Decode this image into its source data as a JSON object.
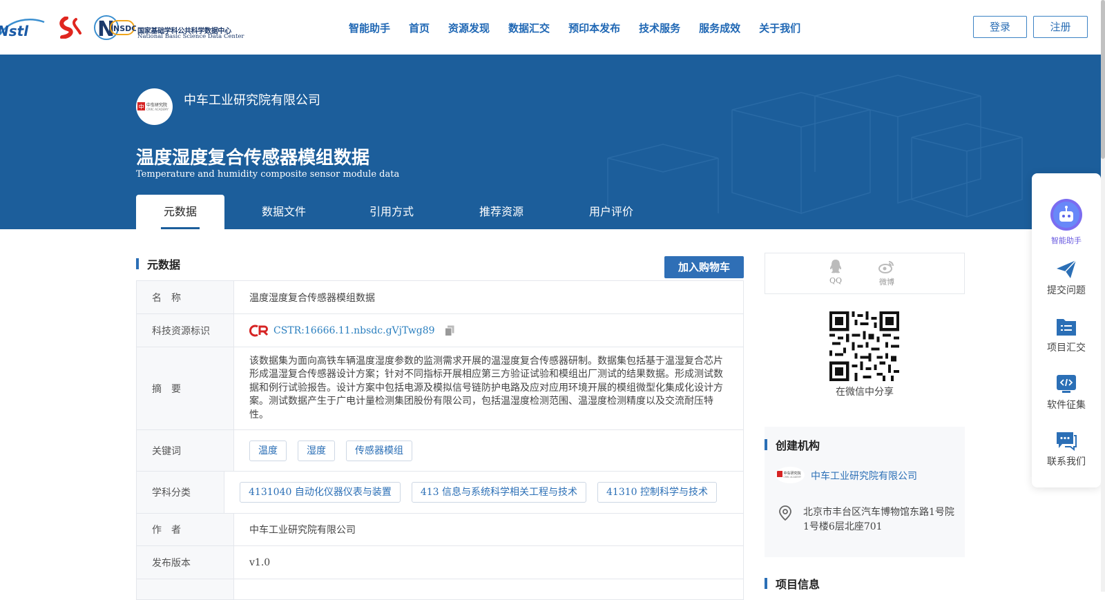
{
  "header": {
    "logos": {
      "nstl": "NSTL",
      "nsdc_badge": "NSDC",
      "nsdc_cn": "国家基础学科公共科学数据中心",
      "nsdc_en": "National Basic Science Data Center"
    },
    "nav": [
      "智能助手",
      "首页",
      "资源发现",
      "数据汇交",
      "预印本发布",
      "技术服务",
      "服务成效",
      "关于我们"
    ],
    "login": "登录",
    "register": "注册"
  },
  "hero": {
    "org_name": "中车工业研究院有限公司",
    "org_logo_text": "中车研究院",
    "title": "温度湿度复合传感器模组数据",
    "subtitle": "Temperature and humidity composite sensor module data",
    "tabs": [
      "元数据",
      "数据文件",
      "引用方式",
      "推荐资源",
      "用户评价"
    ],
    "active_tab": "元数据"
  },
  "metadata": {
    "section_title": "元数据",
    "cart_button": "加入购物车",
    "rows": {
      "name": {
        "label": "名　称",
        "value": "温度湿度复合传感器模组数据"
      },
      "cstr": {
        "label": "科技资源标识",
        "value": "CSTR:16666.11.nbsdc.gVjTwg89"
      },
      "abstract": {
        "label": "摘　要",
        "value": "该数据集为面向高铁车辆温度湿度参数的监测需求开展的温湿度复合传感器研制。数据集包括基于温湿复合芯片形成温湿复合传感器设计方案；针对不同指标开展相应第三方验证试验和模组出厂测试的结果数据。形成测试数据和例行试验报告。设计方案中包括电源及模拟信号链防护电路及应对应用环境开展的模组微型化集成化设计方案。测试数据产生于广电计量检测集团股份有限公司，包括温湿度检测范围、温湿度检测精度以及交流耐压特性。"
      },
      "keywords": {
        "label": "关键词",
        "tags": [
          "温度",
          "湿度",
          "传感器模组"
        ]
      },
      "subjects": {
        "label": "学科分类",
        "tags": [
          "4131040 自动化仪器仪表与装置",
          "413 信息与系统科学相关工程与技术",
          "41310 控制科学与技术"
        ]
      },
      "author": {
        "label": "作　者",
        "value": "中车工业研究院有限公司"
      },
      "version": {
        "label": "发布版本",
        "value": "v1.0"
      }
    }
  },
  "sidebar": {
    "share": {
      "qq": "QQ",
      "weibo": "微博"
    },
    "qr_caption": "在微信中分享",
    "creator": {
      "title": "创建机构",
      "org": "中车工业研究院有限公司",
      "address": "北京市丰台区汽车博物馆东路1号院1号楼6层北座701"
    },
    "project_title": "项目信息"
  },
  "float_panel": {
    "assistant": "智能助手",
    "submit": "提交问题",
    "projects": "项目汇交",
    "software": "软件征集",
    "contact": "联系我们"
  },
  "colors": {
    "brand_blue": "#1c5e9b",
    "link_blue": "#2b6fb6",
    "accent_purple": "#6a5be0"
  }
}
